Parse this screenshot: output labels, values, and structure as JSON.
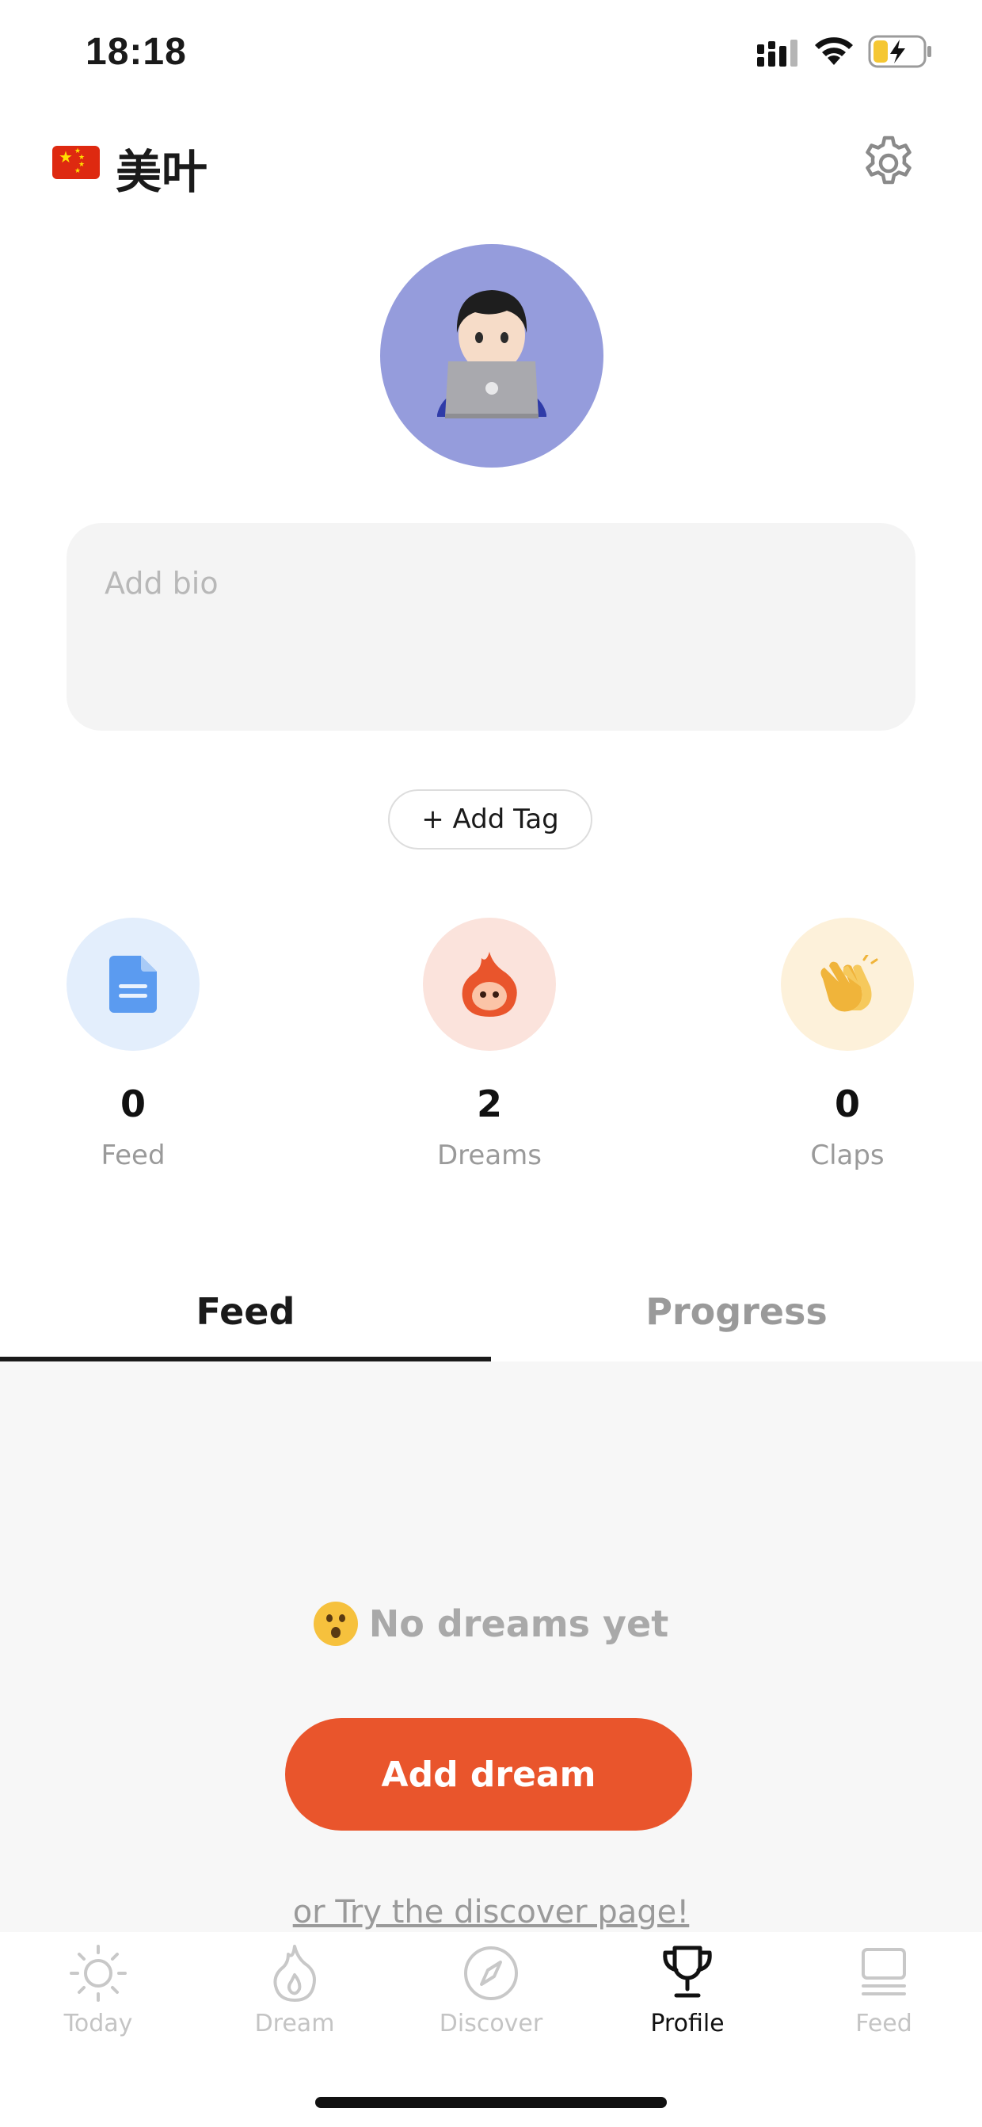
{
  "status_bar": {
    "time": "18:18"
  },
  "header": {
    "flag_icon": "china-flag-icon",
    "username": "美叶",
    "settings_icon": "gear-icon"
  },
  "profile": {
    "avatar_icon": "man-technologist-emoji",
    "avatar_bg_color": "#959cdc",
    "bio_placeholder": "Add bio",
    "add_tag_label": "+ Add Tag"
  },
  "stats": [
    {
      "icon": "document-icon",
      "value": "0",
      "label": "Feed",
      "bg_color": "#e3eefc"
    },
    {
      "icon": "flame-mascot-icon",
      "value": "2",
      "label": "Dreams",
      "bg_color": "#fbe3dc"
    },
    {
      "icon": "clapping-hands-icon",
      "value": "0",
      "label": "Claps",
      "bg_color": "#fdf1da"
    }
  ],
  "tabs": [
    {
      "label": "Feed",
      "active": true
    },
    {
      "label": "Progress",
      "active": false
    }
  ],
  "empty_state": {
    "emoji": "hushed-face-emoji",
    "message": "No dreams yet",
    "button_label": "Add dream",
    "link_text": "or Try the discover page!"
  },
  "bottom_nav": [
    {
      "icon": "sun-icon",
      "label": "Today",
      "active": false
    },
    {
      "icon": "flame-icon",
      "label": "Dream",
      "active": false
    },
    {
      "icon": "compass-icon",
      "label": "Discover",
      "active": false
    },
    {
      "icon": "trophy-icon",
      "label": "Profile",
      "active": true
    },
    {
      "icon": "feed-cards-icon",
      "label": "Feed",
      "active": false
    }
  ],
  "colors": {
    "accent": "#e9552c",
    "text_primary": "#1a1a1a",
    "text_muted": "#9a9a9a"
  }
}
